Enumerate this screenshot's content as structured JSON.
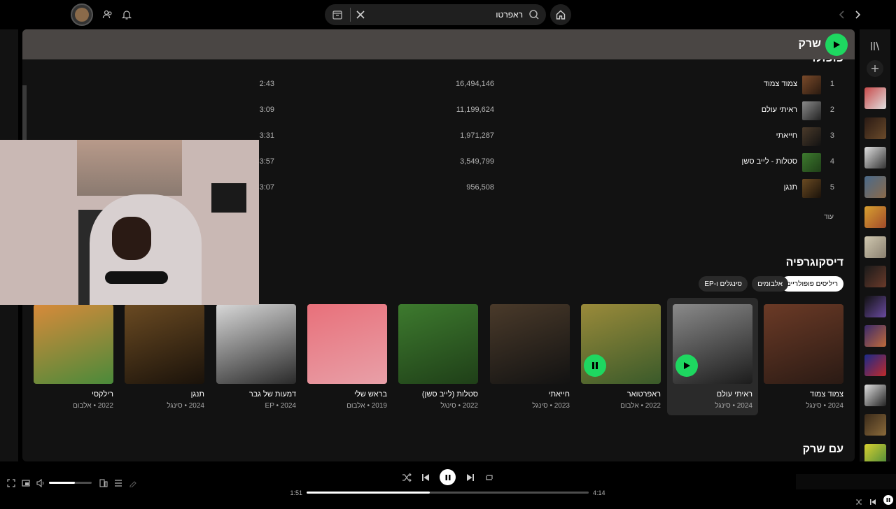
{
  "search": {
    "query": "ראפרטו"
  },
  "header": {
    "artist_name": "שרק"
  },
  "popular": {
    "title": "פופולרי",
    "tracks": [
      {
        "num": "1",
        "title": "צמוד צמוד",
        "plays": "16,494,146",
        "duration": "2:43",
        "color": "#5a3a2a"
      },
      {
        "num": "2",
        "title": "ראיתי עולם",
        "plays": "11,199,624",
        "duration": "3:09",
        "color": "#3c3c3c"
      },
      {
        "num": "3",
        "title": "חייאתי",
        "plays": "1,971,287",
        "duration": "3:31",
        "color": "#3a2e24"
      },
      {
        "num": "4",
        "title": "סטלות - לייב סשן",
        "plays": "3,549,799",
        "duration": "3:57",
        "color": "#2e5a2a"
      },
      {
        "num": "5",
        "title": "תנגן",
        "plays": "956,508",
        "duration": "3:07",
        "color": "#6a4a22"
      }
    ],
    "more_label": "עוד"
  },
  "discography": {
    "title": "דיסקוגרפיה",
    "filters": [
      "ריליסים פופולריים",
      "אלבומים",
      "סינגלים ו-EP"
    ],
    "items": [
      {
        "title": "צמוד צמוד",
        "sub": "2024 • סינגל",
        "c1": "#6b3a26",
        "c2": "#2a1a14"
      },
      {
        "title": "ראיתי עולם",
        "sub": "2024 • סינגל",
        "c1": "#8a8a8a",
        "c2": "#1c1c1c"
      },
      {
        "title": "ראפרטואר",
        "sub": "2022 • אלבום",
        "c1": "#9a8a3a",
        "c2": "#3a5a2a"
      },
      {
        "title": "חייאתי",
        "sub": "2023 • סינגל",
        "c1": "#4a3a2a",
        "c2": "#121212"
      },
      {
        "title": "סטלות (לייב סשן)",
        "sub": "2022 • סינגל",
        "c1": "#3d7a2e",
        "c2": "#1f3f18"
      },
      {
        "title": "בראש שלי",
        "sub": "2019 • אלבום",
        "c1": "#e8707a",
        "c2": "#e8a0a8"
      },
      {
        "title": "דמעות של גבר",
        "sub": "EP • 2024",
        "c1": "#d8d8d8",
        "c2": "#2a2a2a"
      },
      {
        "title": "תנגן",
        "sub": "2024 • סינגל",
        "c1": "#6a4a22",
        "c2": "#1a120a"
      },
      {
        "title": "רילקסי",
        "sub": "2022 • אלבום",
        "c1": "#d88a3a",
        "c2": "#4a8a3a"
      }
    ]
  },
  "appears": {
    "title": "עם שרק"
  },
  "player": {
    "elapsed": "1:51",
    "total": "4:14",
    "progress": 0.437,
    "volume": 0.6
  },
  "colors": {
    "accent": "#1ed760",
    "panel": "#121212"
  }
}
